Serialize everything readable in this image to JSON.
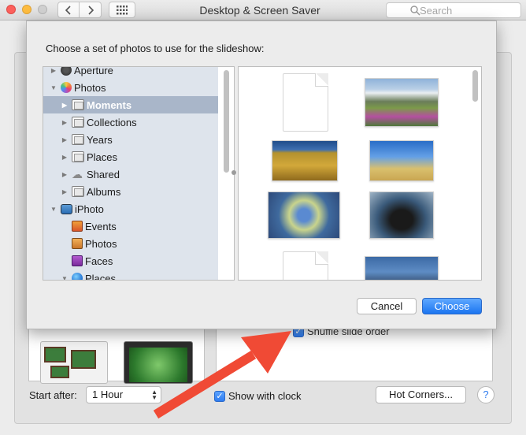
{
  "window": {
    "title": "Desktop & Screen Saver",
    "search_placeholder": "Search"
  },
  "sheet": {
    "prompt": "Choose a set of photos to use for the slideshow:",
    "tree": [
      {
        "label": "Aperture",
        "icon": "aperture-icon",
        "disclosure": "▶",
        "selected": false
      },
      {
        "label": "Photos",
        "icon": "photos-app-icon",
        "disclosure": "▼",
        "selected": false
      },
      {
        "label": "Moments",
        "icon": "folder-icon",
        "disclosure": "▶",
        "selected": true
      },
      {
        "label": "Collections",
        "icon": "folder-icon",
        "disclosure": "▶",
        "selected": false
      },
      {
        "label": "Years",
        "icon": "folder-icon",
        "disclosure": "▶",
        "selected": false
      },
      {
        "label": "Places",
        "icon": "folder-icon",
        "disclosure": "▶",
        "selected": false
      },
      {
        "label": "Shared",
        "icon": "cloud-icon",
        "disclosure": "▶",
        "selected": false
      },
      {
        "label": "Albums",
        "icon": "folder-icon",
        "disclosure": "▶",
        "selected": false
      },
      {
        "label": "iPhoto",
        "icon": "iphoto-icon",
        "disclosure": "▼",
        "selected": false
      },
      {
        "label": "Events",
        "icon": "events-icon",
        "disclosure": "",
        "selected": false
      },
      {
        "label": "Photos",
        "icon": "iphoto-photos-icon",
        "disclosure": "",
        "selected": false
      },
      {
        "label": "Faces",
        "icon": "faces-icon",
        "disclosure": "",
        "selected": false
      },
      {
        "label": "Places",
        "icon": "globe-icon",
        "disclosure": "▼",
        "selected": false
      }
    ],
    "cancel_label": "Cancel",
    "choose_label": "Choose",
    "accent_color": "#1b75f0",
    "selection_color": "#a9b6c9"
  },
  "screensaver": {
    "shuffle_label": "Shuffle slide order",
    "shuffle_checked": true,
    "start_after_label": "Start after:",
    "start_after_value": "1 Hour",
    "show_clock_label": "Show with clock",
    "show_clock_checked": true,
    "hot_corners_label": "Hot Corners...",
    "help_label": "?"
  },
  "annotation": {
    "arrow_color": "#f04a35"
  }
}
